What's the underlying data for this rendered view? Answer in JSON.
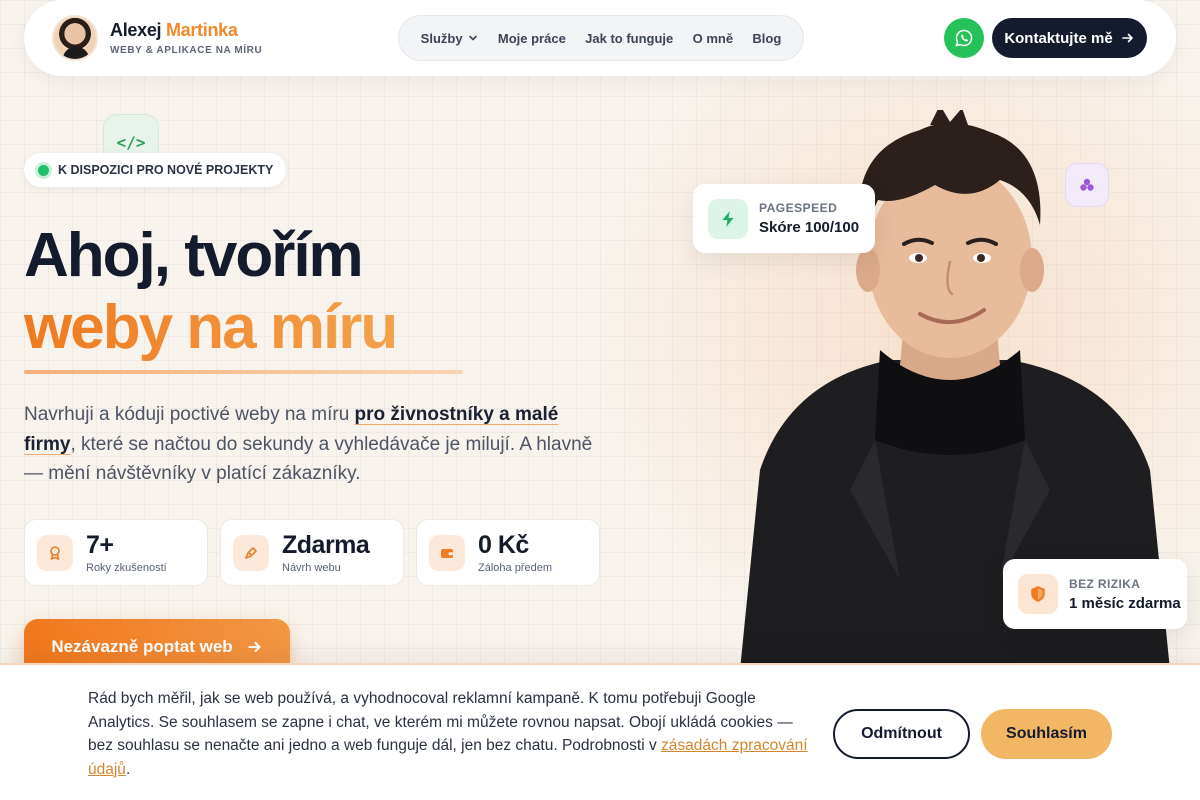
{
  "brand": {
    "first_name": "Alexej",
    "last_name": "Martinka",
    "tagline": "WEBY & APLIKACE NA MÍRU"
  },
  "nav": {
    "items": [
      {
        "label": "Služby",
        "has_dropdown": true
      },
      {
        "label": "Moje práce"
      },
      {
        "label": "Jak to funguje"
      },
      {
        "label": "O mně"
      },
      {
        "label": "Blog"
      }
    ],
    "whatsapp_icon": "whatsapp-icon",
    "contact_label": "Kontaktujte mě"
  },
  "hero": {
    "badge": "K DISPOZICI PRO NOVÉ PROJEKTY",
    "headline_line1": "Ahoj, tvořím",
    "headline_line2": "weby na míru",
    "lead_before": "Navrhuji a kóduji poctivé weby na míru ",
    "lead_highlight": "pro živnostníky a malé firmy",
    "lead_after": ", které se načtou do sekundy a vyhledávače je milují. A hlavně — mění návštěvníky v platící zákazníky.",
    "stats": [
      {
        "icon": "award-icon",
        "value": "7+",
        "label": "Roky zkušeností"
      },
      {
        "icon": "pen-tool-icon",
        "value": "Zdarma",
        "label": "Návrh webu"
      },
      {
        "icon": "wallet-icon",
        "value": "0 Kč",
        "label": "Záloha předem"
      }
    ],
    "cta_label": "Nezávazně poptat web",
    "pagespeed": {
      "label": "PAGESPEED",
      "value": "Skóre 100/100"
    },
    "risk": {
      "label": "BEZ RIZIKA",
      "value": "1 měsíc zdarma"
    }
  },
  "cookie": {
    "text": "Rád bych měřil, jak se web používá, a vyhodnocoval reklamní kampaně. K tomu potřebuji Google Analytics. Se souhlasem se zapne i chat, ve kterém mi můžete rovnou napsat. Obojí ukládá cookies — bez souhlasu se nenačte ani jedno a web funguje dál, jen bez chatu. Podrobnosti v ",
    "link": "zásadách zpracování údajů",
    "text_end": ".",
    "decline": "Odmítnout",
    "accept": "Souhlasím"
  },
  "colors": {
    "accent": "#ef7f24",
    "dark": "#141b2d",
    "whatsapp": "#25c25a",
    "available": "#1fbf6b"
  }
}
